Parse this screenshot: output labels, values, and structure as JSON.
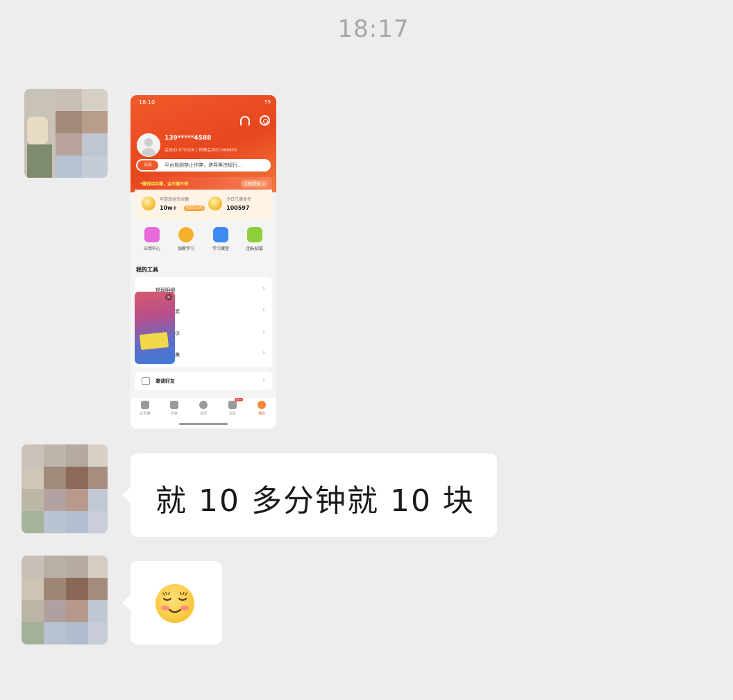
{
  "chat": {
    "timestamp": "18:17",
    "messages": [
      {
        "type": "image",
        "sender": "contact"
      },
      {
        "type": "text",
        "sender": "contact",
        "text": "就 10 多分钟就 10 块"
      },
      {
        "type": "emoji",
        "sender": "contact",
        "emoji": "blushing-smile-emoji"
      }
    ],
    "colors": {
      "background": "#ededed",
      "bubble": "#ffffff",
      "timestamp": "#a6a6a6"
    }
  },
  "shared_screenshot": {
    "status_time": "18:10",
    "status_battery": "59",
    "user": {
      "phone": "139*****4588",
      "ids": "会员ID:970026 | 师傅会员ID:968803"
    },
    "notice": {
      "tag": "公告",
      "text": "平台规则禁止作弊，诱导等违规行..."
    },
    "earnings": {
      "banner_left": "*赚钱用手赚，金币赚不停",
      "banner_right": "立即提现 >",
      "items": [
        {
          "label": "可提现金币余额",
          "value": "10w+",
          "badge": "约10.xx元"
        },
        {
          "label": "今日已赚金币",
          "value": "100597"
        }
      ]
    },
    "quick_actions": [
      {
        "label": "应用中心",
        "color": "#e86ad8"
      },
      {
        "label": "加薪学习",
        "color": "#f5b12c"
      },
      {
        "label": "学习课堂",
        "color": "#3d8af0"
      },
      {
        "label": "团长招募",
        "color": "#8bcf3a"
      }
    ],
    "tools_title": "我的工具",
    "tools": [
      {
        "label": "提现明细"
      },
      {
        "label": "奖"
      },
      {
        "label": "议"
      },
      {
        "label": "美"
      }
    ],
    "invite_label": "邀请好友",
    "tabs": [
      {
        "label": "任务赚"
      },
      {
        "label": "赏卷"
      },
      {
        "label": "发现"
      },
      {
        "label": "消息",
        "badge": "99+"
      },
      {
        "label": "我的"
      }
    ],
    "colors": {
      "header": "#e8461e",
      "accent": "#f05a2a"
    }
  }
}
